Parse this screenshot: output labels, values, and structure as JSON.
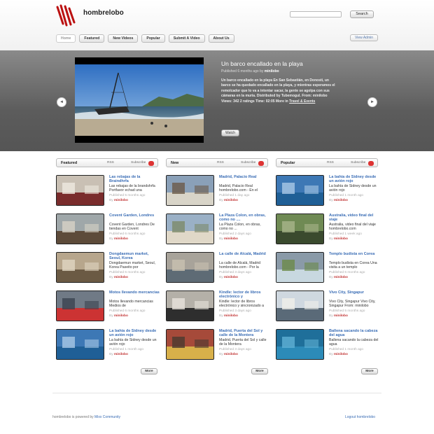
{
  "header": {
    "site_name": "hombrelobo",
    "search_placeholder": "",
    "search_button": "Search",
    "nav": [
      "Home",
      "Featured",
      "New Videos",
      "Popular",
      "Submit A Video",
      "About Us"
    ],
    "view_admin": "View Admin"
  },
  "hero": {
    "title": "Un barco encallado en la playa",
    "published": "Published 6 months ago by",
    "user": "minilobo",
    "description": "Un barco encallado en la playa En San Sebastián, en Donosti, un barco se ha quedado encallado en la playa, y mientras esperamos el remolcador que lo va a intentar sacar, la gente se agolpa con sus cámaras en la muria. Distributed by Tubemogul. From: minilobo Views: 342 2 ratings Time: 02:05 More in",
    "category": "Travel & Events",
    "watch": "Watch",
    "prev": "◄",
    "next": "►"
  },
  "columns": [
    {
      "title": "Featured",
      "rss": "RSS",
      "subscribe": "Subscribe",
      "more": "More",
      "items": [
        {
          "title": "Las rebajas de la Braindhrfa",
          "desc": "Las rebajas de la brandshrfa Portfavor echad una",
          "pub": "Published 5 months ago",
          "by": "minilobo"
        },
        {
          "title": "Covent Garden, Londres",
          "desc": "Covent Garden, Londres De tiendas en Covent",
          "pub": "Published 6 months ago",
          "by": "minilobo"
        },
        {
          "title": "Dongdaemun market, Seoul, Korea",
          "desc": "Dongdaemun market, Seoul, Korea Paseito por",
          "pub": "Published 6 months ago",
          "by": "minilobo"
        },
        {
          "title": "Motos llevando mercancias",
          "desc": "Motos llevando mercancias Medios de",
          "pub": "Published 6 months ago",
          "by": "minilobo"
        },
        {
          "title": "La bahía de Sidney desde un avión rojo",
          "desc": "La bahía de Sidney desde un avión rojo",
          "pub": "Published 1 month ago",
          "by": "minilobo"
        }
      ]
    },
    {
      "title": "New",
      "rss": "RSS",
      "subscribe": "Subscribe",
      "more": "More",
      "items": [
        {
          "title": "Madrid, Palacio Real",
          "desc": "Madrid, Palacio Real hombrelobo.com - En el Palacio Real, en Madrid,",
          "pub": "Published 1 day ago",
          "by": "minilobo"
        },
        {
          "title": "La Plaza Colon, en obras, como no ....",
          "desc": "La Plaza Colon, en obras, como no ...",
          "pub": "Published 2 days ago",
          "by": "minilobo"
        },
        {
          "title": "La calle de Alcalá, Madrid",
          "desc": "La calle de Alcalá, Madrid hombrelobo.com - Por la",
          "pub": "Published 3 days ago",
          "by": "minilobo"
        },
        {
          "title": "Kindle: lector de libros electrónico y",
          "desc": "Kindle: lector de libros electrónico y sincronizado a",
          "pub": "Published 3 days ago",
          "by": "minilobo"
        },
        {
          "title": "Madrid, Puerta del Sol y calle de la Montera",
          "desc": "Madrid, Puerta del Sol y calle de la Montera",
          "pub": "Published 3 days ago",
          "by": "minilobo"
        }
      ]
    },
    {
      "title": "Popular",
      "rss": "RSS",
      "subscribe": "Subscribe",
      "more": "More",
      "items": [
        {
          "title": "La bahía de Sidney desde un avión rojo",
          "desc": "La bahía de Sidney desde un avión rojo",
          "pub": "Published 1 month ago",
          "by": "minilobo"
        },
        {
          "title": "Australia, video final del viaje",
          "desc": "Australia, video final del viaje hombrelobo.com",
          "pub": "Published 1 week ago",
          "by": "minilobo"
        },
        {
          "title": "Templo budista en Corea",
          "desc": "Templo budista en Corea Una visita a un templo",
          "pub": "Published 6 months ago",
          "by": "minilobo"
        },
        {
          "title": "Vivo City, Singapur",
          "desc": "Vivo City, Singapur Vivo City, Singapur From: minilobo Views: 2027 1",
          "pub": "Published 5 months ago",
          "by": "minilobo"
        },
        {
          "title": "Ballena sacando la cabeza del agua",
          "desc": "Ballena sacando la cabeza del agua",
          "pub": "Published 1 month ago",
          "by": "minilobo"
        }
      ]
    }
  ],
  "footer": {
    "powered": "hombrelobo is powered by",
    "powered_link": "Mixx Community",
    "logout": "Logout hombrelobo"
  }
}
